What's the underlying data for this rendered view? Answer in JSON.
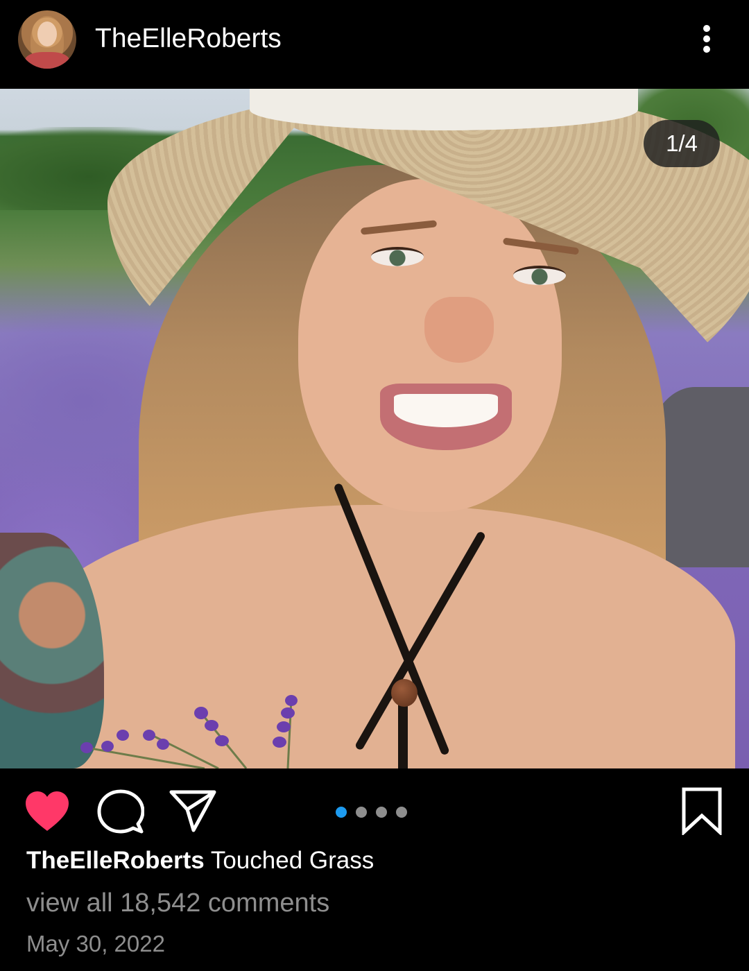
{
  "header": {
    "username": "TheElleRoberts",
    "avatar_icon": "profile-avatar",
    "more_icon": "more-vertical-icon"
  },
  "post": {
    "image_counter": "1/4",
    "carousel": {
      "total": 4,
      "active_index": 0
    }
  },
  "actions": {
    "like_icon": "heart-filled-icon",
    "like_color": "#ff3868",
    "comment_icon": "comment-bubble-icon",
    "share_icon": "paper-plane-icon",
    "save_icon": "bookmark-icon",
    "active_dot_color": "#1d9bf0"
  },
  "caption": {
    "username": "TheElleRoberts",
    "text": " Touched Grass"
  },
  "comments": {
    "link_text": "view all 18,542 comments"
  },
  "date": "May 30, 2022"
}
